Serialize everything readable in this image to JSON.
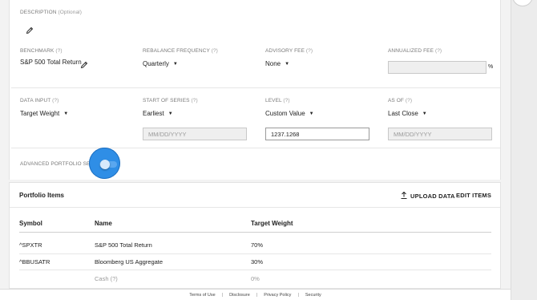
{
  "description": {
    "label": "DESCRIPTION",
    "optional": "(Optional)"
  },
  "benchmark": {
    "label": "BENCHMARK",
    "help": "(?)",
    "value": "S&P 500 Total Return"
  },
  "rebalance": {
    "label": "REBALANCE FREQUENCY",
    "help": "(?)",
    "value": "Quarterly"
  },
  "advisory_fee": {
    "label": "ADVISORY FEE",
    "help": "(?)",
    "value": "None"
  },
  "annualized_fee": {
    "label": "ANNUALIZED FEE",
    "help": "(?)",
    "unit": "%"
  },
  "data_input": {
    "label": "DATA INPUT",
    "help": "(?)",
    "value": "Target Weight"
  },
  "start_of_series": {
    "label": "START OF SERIES",
    "help": "(?)",
    "value": "Earliest",
    "placeholder": "MM/DD/YYYY"
  },
  "level": {
    "label": "LEVEL",
    "help": "(?)",
    "value": "Custom Value",
    "input_value": "1237.1268"
  },
  "as_of": {
    "label": "AS OF",
    "help": "(?)",
    "value": "Last Close",
    "placeholder": "MM/DD/YYYY"
  },
  "advanced": {
    "label": "ADVANCED PORTFOLIO SETTINGS",
    "toggle_on": true
  },
  "portfolio": {
    "title": "Portfolio Items",
    "upload_label": "UPLOAD DATA",
    "edit_label": "EDIT ITEMS",
    "columns": {
      "symbol": "Symbol",
      "name": "Name",
      "weight": "Target Weight"
    },
    "rows": [
      {
        "symbol": "^SPXTR",
        "name": "S&P 500 Total Return",
        "weight": "70%"
      },
      {
        "symbol": "^BBUSATR",
        "name": "Bloomberg US Aggregate",
        "weight": "30%"
      },
      {
        "symbol": "",
        "name": "Cash (?)",
        "weight": "0%"
      }
    ]
  },
  "footer": {
    "links": [
      "Terms of Use",
      "Disclosure",
      "Privacy Policy",
      "Security"
    ]
  },
  "colors": {
    "accent": "#2f8ee6",
    "toggle_track": "#5aa7ef"
  }
}
